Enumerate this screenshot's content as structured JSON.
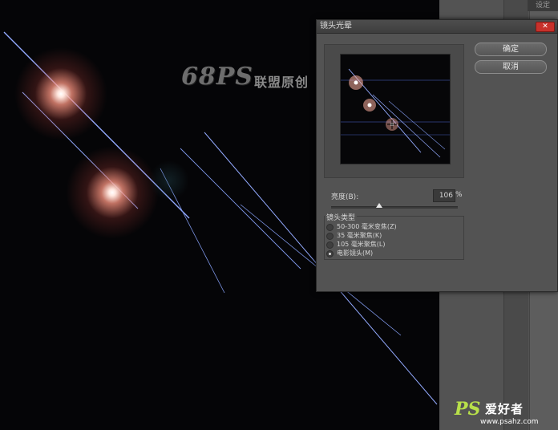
{
  "watermark_top": {
    "logo": "68PS",
    "text": "联盟原创"
  },
  "watermark_bottom": {
    "logo": "PS",
    "text": "爱好者",
    "url": "www.psahz.com"
  },
  "right_panel": {
    "label": "设定"
  },
  "dialog": {
    "title": "镜头光晕",
    "ok_label": "确定",
    "cancel_label": "取消",
    "brightness": {
      "label": "亮度(B):",
      "value": "106",
      "unit": "%",
      "slider_fraction": 0.38
    },
    "lens_type": {
      "title": "镜头类型",
      "options": [
        {
          "label": "50-300 毫米变焦(Z)",
          "selected": false
        },
        {
          "label": "35 毫米聚焦(K)",
          "selected": false
        },
        {
          "label": "105 毫米聚焦(L)",
          "selected": false
        },
        {
          "label": "电影镜头(M)",
          "selected": true
        }
      ]
    }
  },
  "colors": {
    "canvas": "#050507",
    "panel": "#535353",
    "flare": "#ffb8a6",
    "line": "#8fa8ff",
    "close": "#c8312b"
  }
}
